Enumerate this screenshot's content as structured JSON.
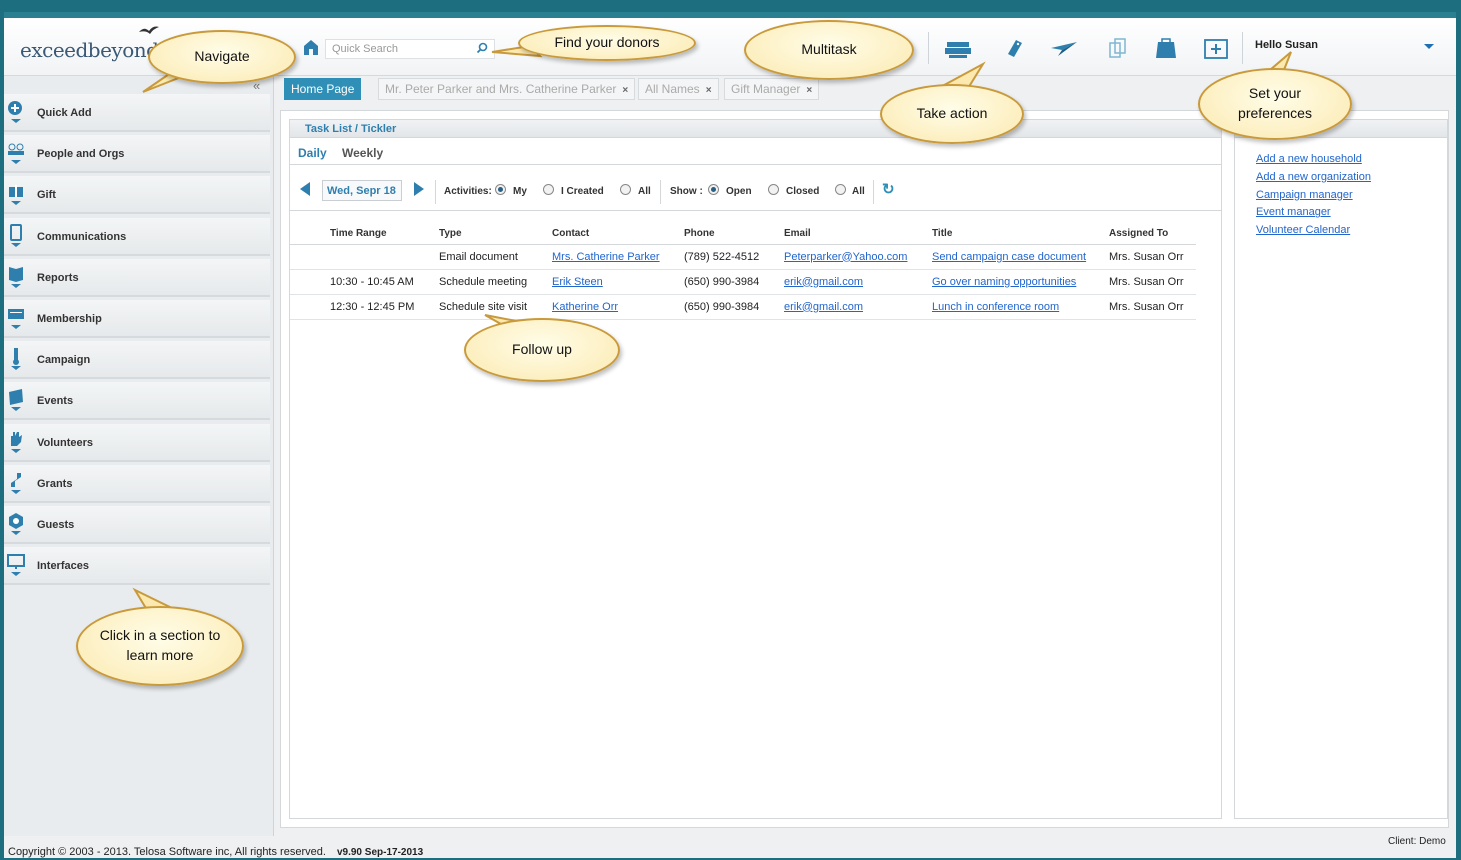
{
  "app": {
    "logo_text": "exceedbeyond",
    "greeting": "Hello Susan",
    "client_label": "Client: Demo"
  },
  "search": {
    "placeholder": "Quick Search"
  },
  "toolbar": {
    "icons": [
      "printer-icon",
      "tag-icon",
      "paper-plane-icon",
      "copy-icon",
      "toolbox-icon",
      "add-window-icon"
    ]
  },
  "sidebar": {
    "collapse_label": "«",
    "items": [
      {
        "label": "Quick Add",
        "icon": "plus-circle-icon"
      },
      {
        "label": "People and Orgs",
        "icon": "people-icon"
      },
      {
        "label": "Gift",
        "icon": "gift-icon"
      },
      {
        "label": "Communications",
        "icon": "phone-icon"
      },
      {
        "label": "Reports",
        "icon": "book-icon"
      },
      {
        "label": "Membership",
        "icon": "card-icon"
      },
      {
        "label": "Campaign",
        "icon": "thermometer-icon"
      },
      {
        "label": "Events",
        "icon": "calendar-icon"
      },
      {
        "label": "Volunteers",
        "icon": "hand-icon"
      },
      {
        "label": "Grants",
        "icon": "grant-icon"
      },
      {
        "label": "Guests",
        "icon": "guest-icon"
      },
      {
        "label": "Interfaces",
        "icon": "monitor-icon"
      }
    ]
  },
  "tabs": [
    {
      "label": "Home Page",
      "closable": false,
      "active": true
    },
    {
      "label": "Mr. Peter Parker and Mrs. Catherine Parker",
      "closable": true,
      "active": false
    },
    {
      "label": "All Names",
      "closable": true,
      "active": false
    },
    {
      "label": "Gift Manager",
      "closable": true,
      "active": false
    }
  ],
  "tab_close": "×",
  "task_panel": {
    "title": "Task List / Tickler",
    "subtabs": [
      "Daily",
      "Weekly"
    ],
    "date": "Wed, Sepr 18",
    "activities_label": "Activities:",
    "activities_options": [
      "My",
      "I Created",
      "All"
    ],
    "activities_selected": "My",
    "show_label": "Show :",
    "show_options": [
      "Open",
      "Closed",
      "All"
    ],
    "show_selected": "Open",
    "refresh_symbol": "↻",
    "columns": [
      "Time Range",
      "Type",
      "Contact",
      "Phone",
      "Email",
      "Title",
      "Assigned To"
    ],
    "rows": [
      {
        "time": "",
        "type": "Email document",
        "contact": "Mrs. Catherine Parker",
        "phone": "(789) 522-4512",
        "email": "Peterparker@Yahoo.com",
        "title": "Send campaign case document",
        "assigned": "Mrs. Susan Orr"
      },
      {
        "time": "10:30 - 10:45 AM",
        "type": "Schedule meeting",
        "contact": "Erik Steen",
        "phone": "(650) 990-3984",
        "email": "erik@gmail.com",
        "title": "Go over naming opportunities",
        "assigned": "Mrs. Susan Orr"
      },
      {
        "time": "12:30 - 12:45 PM",
        "type": "Schedule site visit",
        "contact": "Katherine Orr",
        "phone": "(650) 990-3984",
        "email": "erik@gmail.com",
        "title": "Lunch in conference room",
        "assigned": "Mrs. Susan Orr"
      }
    ]
  },
  "quick_links": [
    "Add a new household",
    "Add a new organization",
    "Campaign manager",
    "Event manager",
    "Volunteer Calendar"
  ],
  "footer": {
    "copyright": "Copyright © 2003 - 2013. Telosa Software inc, All rights reserved.",
    "version": "v9.90 Sep-17-2013"
  },
  "callouts": {
    "navigate": "Navigate",
    "find_donors": "Find your donors",
    "multitask": "Multitask",
    "take_action": "Take action",
    "preferences_1": "Set your",
    "preferences_2": "preferences",
    "follow_up": "Follow up",
    "click_section_1": "Click in a section to",
    "click_section_2": "learn more"
  },
  "colors": {
    "accent": "#2f8fb6",
    "link": "#2266cc",
    "callout_border": "#c99a3b",
    "callout_fill": "#fbe9b0"
  }
}
